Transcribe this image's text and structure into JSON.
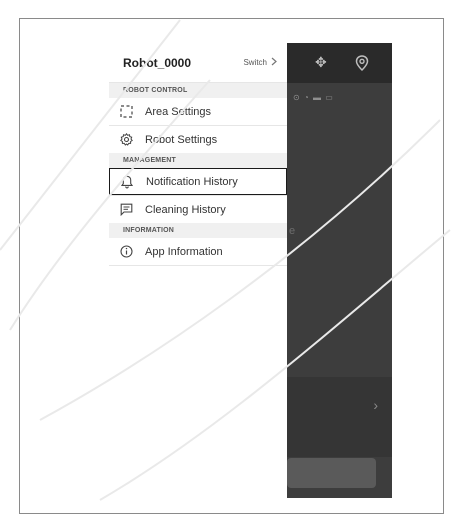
{
  "header": {
    "robot_name": "Robot_0000",
    "switch_label": "Switch"
  },
  "sections": {
    "robot_control": "ROBOT CONTROL",
    "management": "MANAGEMENT",
    "information": "INFORMATION"
  },
  "items": {
    "area_settings": "Area Settings",
    "robot_settings": "Robot Settings",
    "notification_history": "Notification History",
    "cleaning_history": "Cleaning History",
    "app_information": "App Information"
  },
  "background": {
    "status_glyphs": "⊙  ◔ ▬ ▭"
  },
  "icons": [
    "chevron-right-icon",
    "area-icon",
    "gear-icon",
    "bell-icon",
    "message-icon",
    "info-icon",
    "move-icon",
    "location-icon"
  ]
}
